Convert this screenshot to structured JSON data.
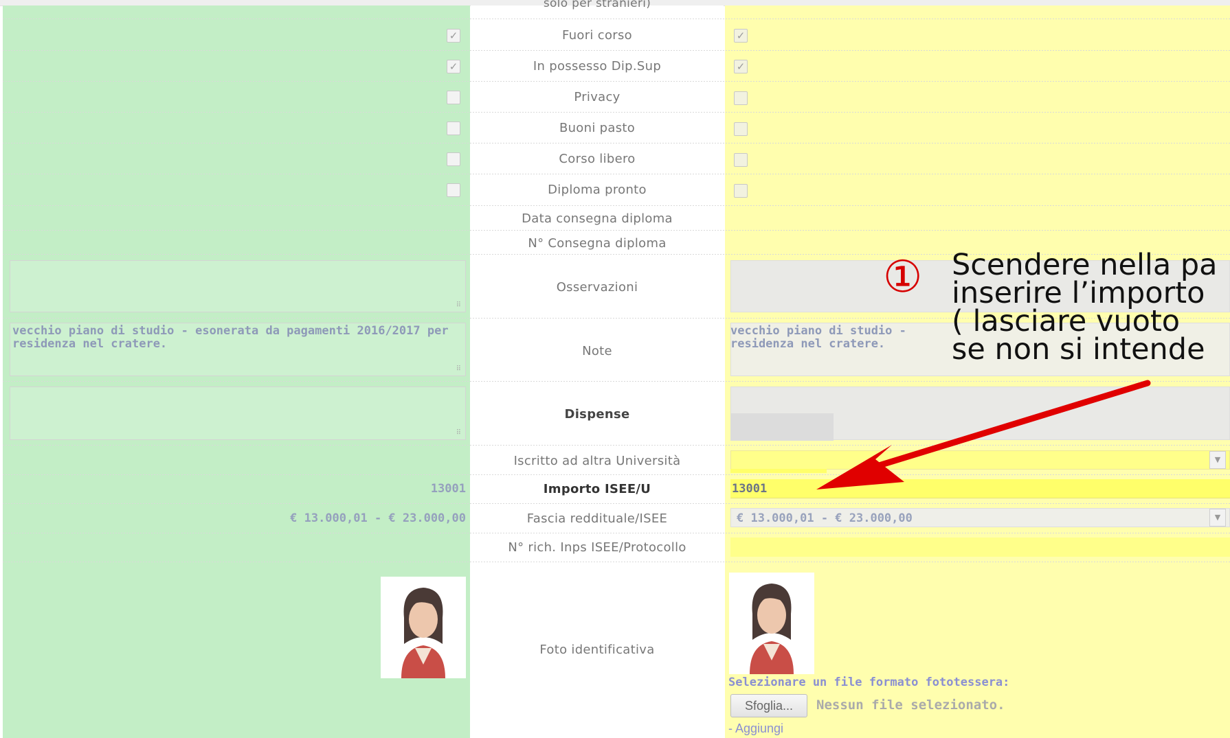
{
  "header_partial": "solo per stranieri)",
  "rows": {
    "fuori_corso": "Fuori corso",
    "possesso_dip": "In possesso Dip.Sup",
    "privacy": "Privacy",
    "buoni_pasto": "Buoni pasto",
    "corso_libero": "Corso libero",
    "diploma_pronto": "Diploma pronto",
    "data_consegna": "Data consegna diploma",
    "n_consegna": "N° Consegna diploma",
    "osservazioni": "Osservazioni",
    "note": "Note",
    "dispense": "Dispense",
    "iscritto_altra": "Iscritto ad altra Università",
    "importo_isee": "Importo ISEE/U",
    "fascia": "Fascia reddituale/ISEE",
    "n_rich_inps": "N° rich. Inps ISEE/Protocollo",
    "foto": "Foto identificativa"
  },
  "checkbox_check": "✓",
  "checkboxes": {
    "fuori_corso": true,
    "possesso_dip": true,
    "privacy": false,
    "buoni_pasto": false,
    "corso_libero": false,
    "diploma_pronto": false
  },
  "left": {
    "note_text": "vecchio piano di studio - esonerata da pagamenti 2016/2017 per residenza nel cratere.",
    "importo_isee": "13001",
    "fascia": "€ 13.000,01 - € 23.000,00"
  },
  "right": {
    "note_text_line1": "vecchio piano di studio - esone",
    "note_text_line2": "residenza nel cratere.",
    "importo_isee": "13001",
    "fascia": "€ 13.000,01 - € 23.000,00",
    "file_prompt": "Selezionare un file formato fototessera:",
    "browse_button": "Sfoglia...",
    "no_file": "Nessun file selezionato.",
    "add_link": "- Aggiungi"
  },
  "annotation": {
    "number": "①",
    "line1": "Scendere nella pa",
    "line2": "inserire l’importo",
    "line3": "( lasciare vuoto",
    "line4": "se non si intende"
  },
  "colors": {
    "left_bg": "#c3eec6",
    "right_bg": "#fffeae",
    "highlight": "#ffff6a",
    "annotation_red": "#e00000"
  }
}
